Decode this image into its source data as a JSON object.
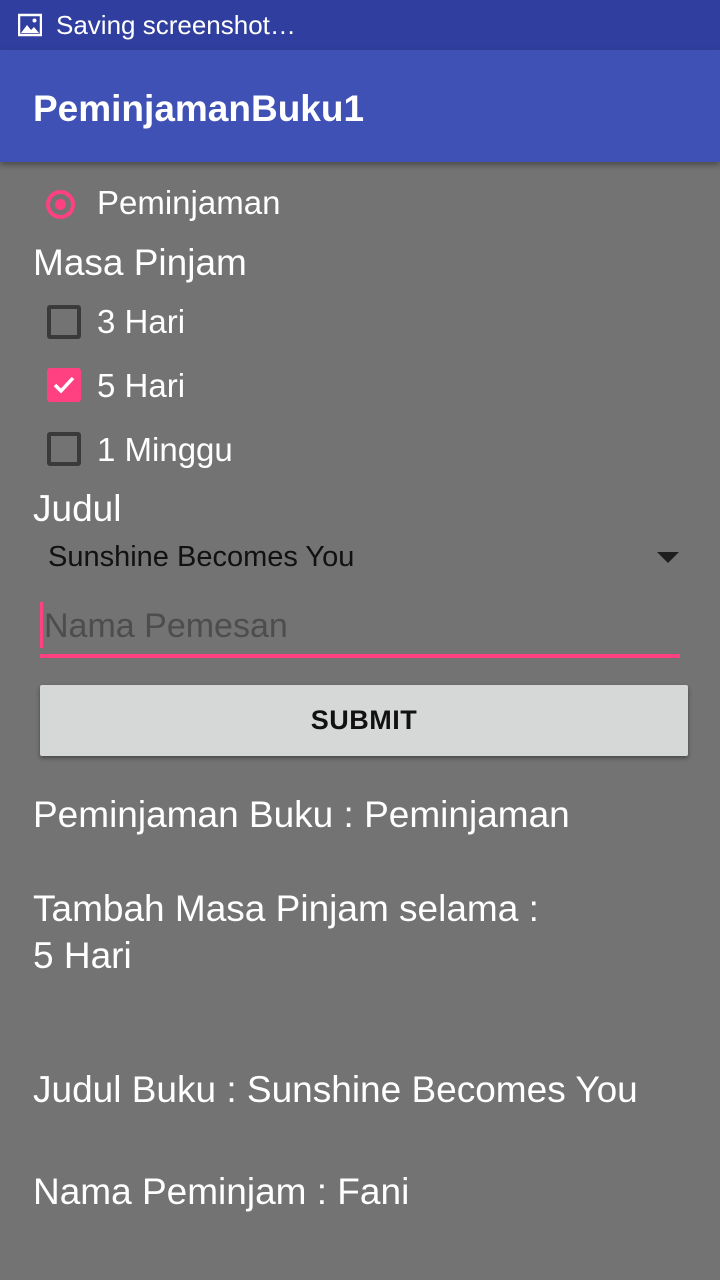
{
  "status_bar": {
    "text": "Saving screenshot…",
    "icon": "image-icon"
  },
  "app_bar": {
    "title": "PeminjamanBuku1"
  },
  "radio": {
    "label": "Peminjaman",
    "checked": true
  },
  "masa_pinjam": {
    "label": "Masa Pinjam",
    "options": [
      {
        "label": "3 Hari",
        "checked": false
      },
      {
        "label": "5 Hari",
        "checked": true
      },
      {
        "label": "1 Minggu",
        "checked": false
      }
    ]
  },
  "judul": {
    "label": "Judul",
    "selected": "Sunshine Becomes You"
  },
  "nama_field": {
    "placeholder": "Nama Pemesan",
    "value": ""
  },
  "submit": {
    "label": "SUBMIT"
  },
  "results": {
    "peminjaman": "Peminjaman Buku : Peminjaman",
    "masa_line1": "Tambah Masa Pinjam selama :",
    "masa_line2": "5 Hari",
    "judul": "Judul Buku : Sunshine Becomes You",
    "nama": "Nama Peminjam : Fani"
  },
  "colors": {
    "primary": "#3f51b5",
    "primary_dark": "#303f9f",
    "accent": "#ff4081",
    "background": "#737373"
  }
}
